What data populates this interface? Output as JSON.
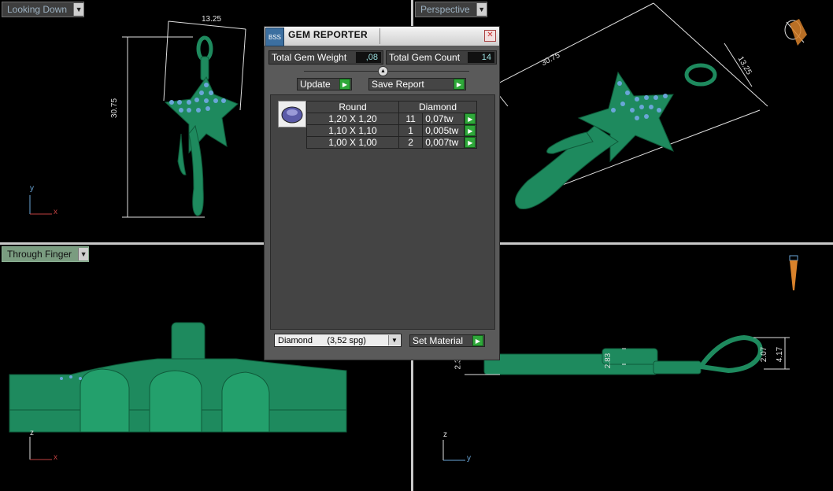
{
  "viewports": {
    "top_left": {
      "label": "Looking Down",
      "axis_y": "y",
      "axis_x": "x",
      "dims": {
        "width": "13.25",
        "height": "30.75"
      }
    },
    "top_right": {
      "label": "Perspective",
      "dims": {
        "length": "30.75",
        "width": "13.25"
      }
    },
    "bottom_left": {
      "label": "Through Finger",
      "axis_z": "z",
      "axis_x": "x"
    },
    "bottom_right": {
      "axis_z": "z",
      "axis_y": "y",
      "dims": {
        "left_height": "2.3",
        "mid_height": "2.83",
        "bail_inner": "2.07",
        "bail_outer": "4.17"
      }
    }
  },
  "gem_reporter": {
    "title": "GEM REPORTER",
    "logo": "BSS",
    "total_weight_label": "Total Gem Weight",
    "total_weight_value": ",08",
    "total_count_label": "Total Gem Count",
    "total_count_value": "14",
    "update_label": "Update",
    "save_report_label": "Save Report",
    "table": {
      "headers": [
        "Round",
        "Diamond"
      ],
      "rows": [
        {
          "size": "1,20 X 1,20",
          "count": "11",
          "weight": "0,07tw"
        },
        {
          "size": "1,10 X 1,10",
          "count": "1",
          "weight": "0,005tw"
        },
        {
          "size": "1,00 X 1,00",
          "count": "2",
          "weight": "0,007tw"
        }
      ]
    },
    "material_select": "Diamond      (3,52 spg)",
    "set_material_label": "Set Material"
  },
  "colors": {
    "model": "#1e8a5e",
    "gem": "#6aa6d8",
    "dimension": "#e0e0e0",
    "accent_green": "#2fa83a"
  },
  "icons": {
    "close": "close-icon",
    "go": "play-arrow-icon",
    "dropdown": "chevron-down-icon"
  }
}
